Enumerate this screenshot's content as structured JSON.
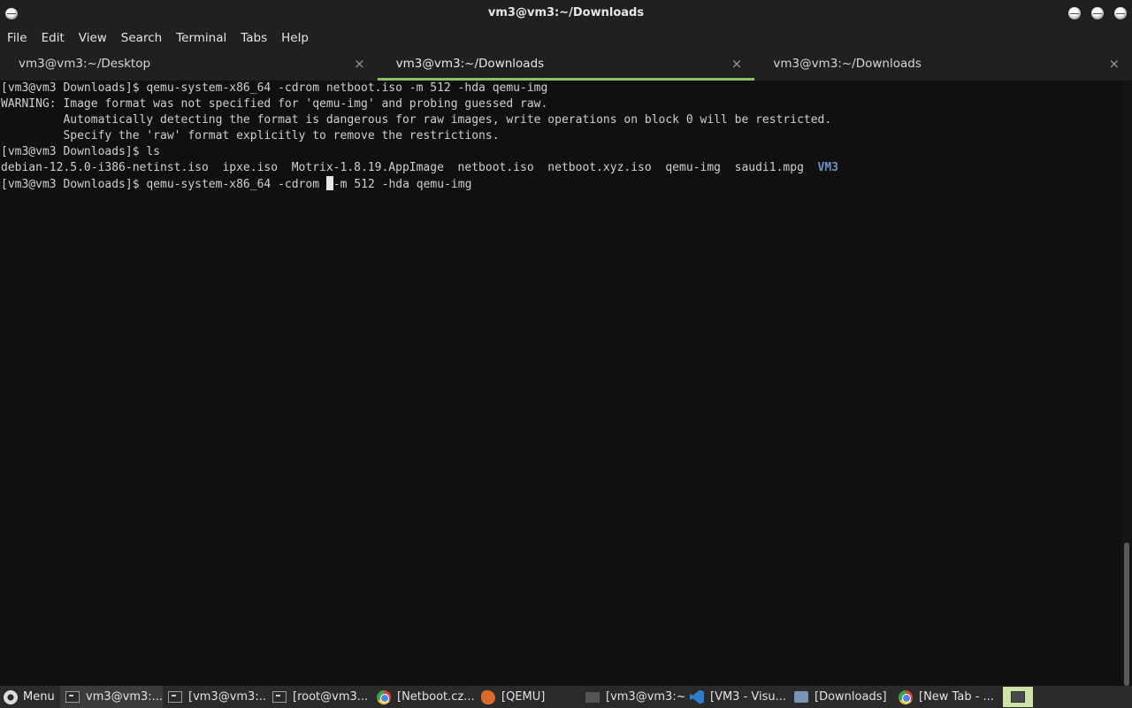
{
  "window": {
    "title": "vm3@vm3:~/Downloads"
  },
  "menubar": [
    "File",
    "Edit",
    "View",
    "Search",
    "Terminal",
    "Tabs",
    "Help"
  ],
  "tabs": [
    {
      "label": "vm3@vm3:~/Desktop",
      "active": false,
      "close": "×"
    },
    {
      "label": "vm3@vm3:~/Downloads",
      "active": true,
      "close": "×"
    },
    {
      "label": "vm3@vm3:~/Downloads",
      "active": false,
      "close": "×"
    }
  ],
  "terminal": {
    "lines": [
      "[vm3@vm3 Downloads]$ qemu-system-x86_64 -cdrom netboot.iso -m 512 -hda qemu-img",
      "WARNING: Image format was not specified for 'qemu-img' and probing guessed raw.",
      "         Automatically detecting the format is dangerous for raw images, write operations on block 0 will be restricted.",
      "         Specify the 'raw' format explicitly to remove the restrictions.",
      "[vm3@vm3 Downloads]$ ls"
    ],
    "ls_files": "debian-12.5.0-i386-netinst.iso  ipxe.iso  Motrix-1.8.19.AppImage  netboot.iso  netboot.xyz.iso  qemu-img  saudi1.mpg  ",
    "ls_dir": "VM3",
    "current_before_cursor": "[vm3@vm3 Downloads]$ qemu-system-x86_64 -cdrom ",
    "current_after_cursor": "-m 512 -hda qemu-img"
  },
  "taskbar": {
    "menu_label": "Menu",
    "items": [
      {
        "label": "vm3@vm3:...",
        "icon": "terminal-icon",
        "active": true
      },
      {
        "label": "[vm3@vm3:...",
        "icon": "terminal-icon",
        "active": false
      },
      {
        "label": "[root@vm3...",
        "icon": "terminal-icon",
        "active": false
      },
      {
        "label": "[Netboot.cz...",
        "icon": "chrome-icon",
        "active": false
      },
      {
        "label": "[QEMU]",
        "icon": "qemu-icon",
        "active": false
      },
      {
        "label": "[vm3@vm3:~]",
        "icon": "terminal-icon",
        "active": false
      },
      {
        "label": "[VM3 - Visu...",
        "icon": "vscode-icon",
        "active": false
      },
      {
        "label": "[Downloads]",
        "icon": "folder-icon",
        "active": false
      },
      {
        "label": "[New Tab - ...",
        "icon": "chrome-icon",
        "active": false
      }
    ]
  }
}
